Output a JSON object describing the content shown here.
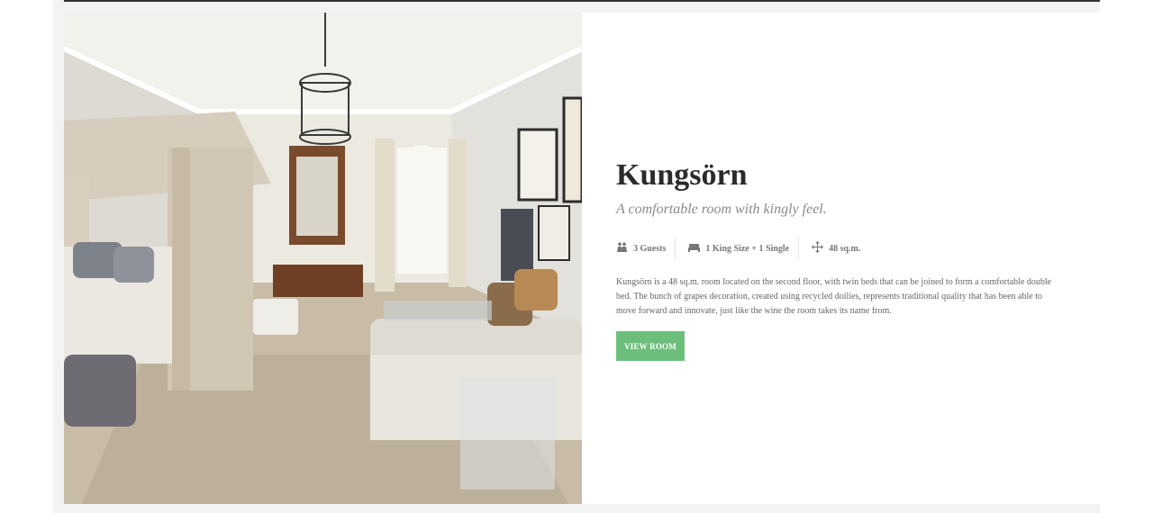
{
  "room": {
    "title": "Kungsörn",
    "subtitle": "A comfortable room with kingly feel.",
    "features": [
      {
        "icon": "guests-icon",
        "label": "3 Guests"
      },
      {
        "icon": "bed-icon",
        "label": "1 King Size + 1 Single"
      },
      {
        "icon": "size-icon",
        "label": "48 sq.m."
      }
    ],
    "description": "Kungsörn is a 48 sq.m. room located on the second floor, with twin beds that can be joined to form a comfortable double bed. The bunch of grapes decoration, created using recycled doilies, represents traditional quality that has been able to move forward and innovate, just like the wine the room takes its name from.",
    "button_label": "VIEW ROOM",
    "photo_alt": "Bedroom photo"
  },
  "colors": {
    "accent": "#6cbf7b",
    "title": "#2b2b2b",
    "subtitle": "#8a8a8a",
    "text": "#666666"
  }
}
